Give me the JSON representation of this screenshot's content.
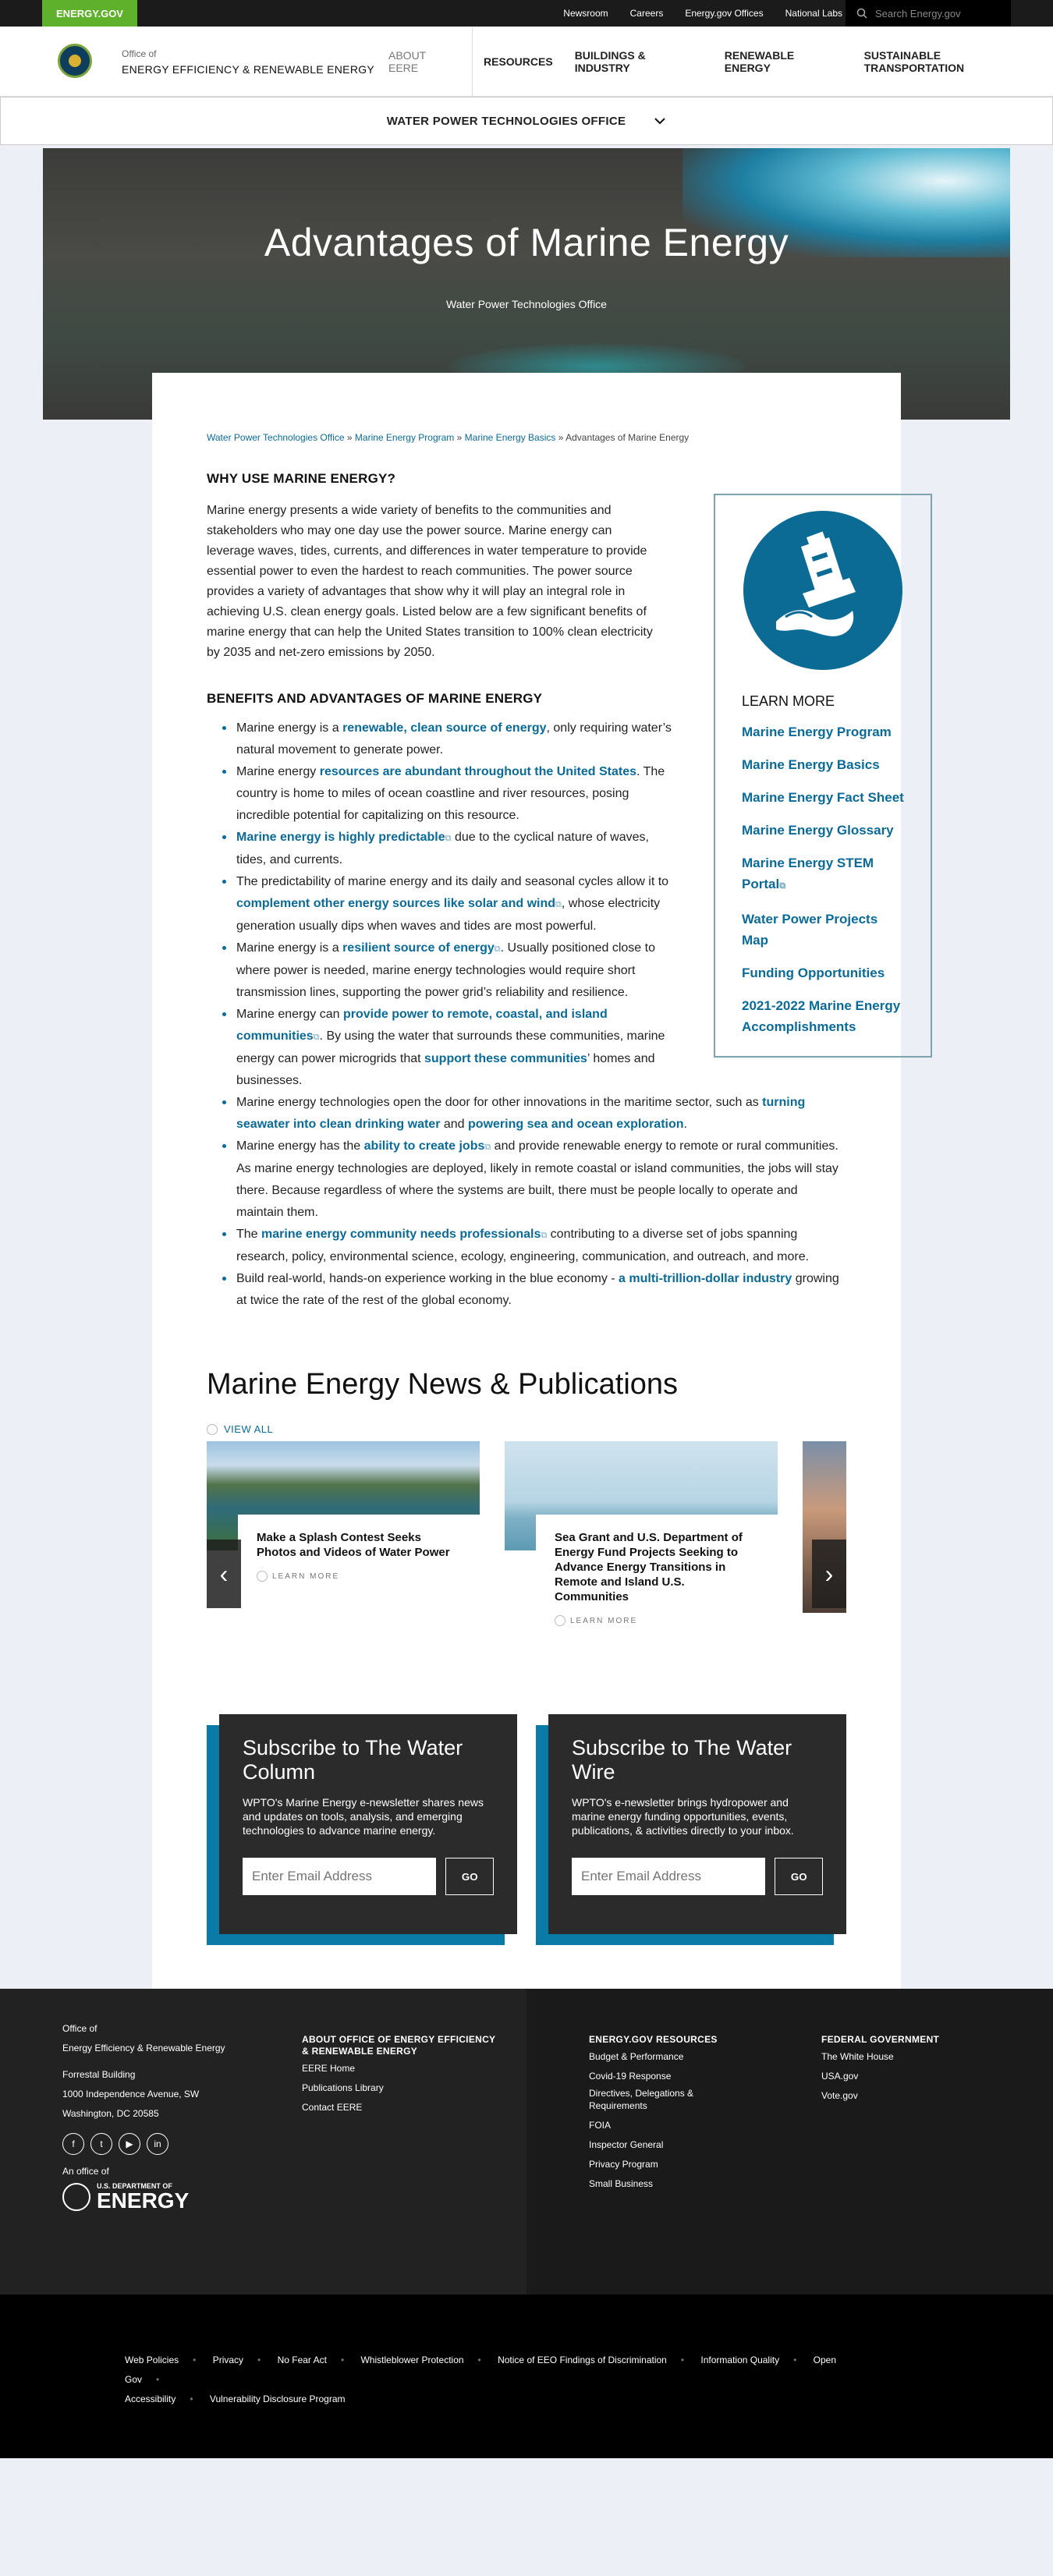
{
  "topbar": {
    "brand": "ENERGY.GOV",
    "links": [
      "Newsroom",
      "Careers",
      "Energy.gov Offices",
      "National Labs"
    ],
    "search_placeholder": "Search Energy.gov"
  },
  "header": {
    "office_of": "Office of",
    "office_name": "ENERGY EFFICIENCY & RENEWABLE ENERGY",
    "nav": [
      "ABOUT EERE",
      "RESOURCES",
      "BUILDINGS & INDUSTRY",
      "RENEWABLE ENERGY",
      "SUSTAINABLE TRANSPORTATION"
    ]
  },
  "subnav": {
    "label": "WATER POWER TECHNOLOGIES OFFICE"
  },
  "hero": {
    "title": "Advantages of Marine Energy",
    "subtitle": "Water Power Technologies Office"
  },
  "breadcrumbs": {
    "items": [
      "Water Power Technologies Office",
      "Marine Energy Program",
      "Marine Energy Basics"
    ],
    "current": "Advantages of Marine Energy",
    "sep": "»"
  },
  "why": {
    "heading": "WHY USE MARINE ENERGY?",
    "text": "Marine energy presents a wide variety of benefits to the communities and stakeholders who may one day use the power source. Marine energy can leverage waves, tides, currents, and differences in water temperature to provide essential power to even the hardest to reach communities. The power source provides a variety of advantages that show why it will play an integral role in achieving U.S. clean energy goals. Listed below are a few significant benefits of marine energy that can help the United States transition to 100% clean electricity by 2035 and net-zero emissions by 2050."
  },
  "learn": {
    "heading": "LEARN MORE",
    "links": [
      "Marine Energy Program",
      "Marine Energy Basics",
      "Marine Energy Fact Sheet",
      "Marine Energy Glossary",
      "Marine Energy STEM Portal",
      "Water Power Projects Map",
      "Funding Opportunities",
      "2021-2022 Marine Energy Accomplishments"
    ]
  },
  "benefits": {
    "heading": "BENEFITS AND ADVANTAGES OF MARINE ENERGY",
    "b1": {
      "pre": "Marine energy is a ",
      "link": "renewable, clean source of energy",
      "post": ", only requiring water’s natural movement to generate power."
    },
    "b2": {
      "pre": "Marine energy ",
      "link": "resources are abundant throughout the United States",
      "post": ". The country is home to miles of ocean coastline and river resources, posing incredible potential for capitalizing on this resource."
    },
    "b3": {
      "link": "Marine energy is highly predictable",
      "post": " due to the cyclical nature of waves, tides, and currents."
    },
    "b4": {
      "pre": "The predictability of marine energy and its daily and seasonal cycles allow it to ",
      "link": "complement other energy sources like solar and wind",
      "post": ", whose electricity generation usually dips when waves and tides are most powerful."
    },
    "b5": {
      "pre": "Marine energy is a ",
      "link": "resilient source of energy",
      "post": ". Usually positioned close to where power is needed, marine energy technologies would require short transmission lines, supporting the power grid’s reliability and resilience."
    },
    "b6": {
      "pre": "Marine energy can ",
      "link": "provide power to remote, coastal, and island communities",
      "mid": ". By using the water that surrounds these communities, marine energy can power microgrids that ",
      "link2": "support these communities",
      "post": "’ homes and businesses."
    },
    "b7": {
      "pre": "Marine energy technologies open the door for other innovations in the maritime sector, such as ",
      "link": "turning seawater into clean drinking water",
      "mid": " and ",
      "link2": "powering sea and ocean exploration",
      "post": "."
    },
    "b8": {
      "pre": "Marine energy has the ",
      "link": "ability to create jobs",
      "post": " and provide renewable energy to remote or rural communities. As marine energy technologies are deployed, likely in remote coastal or island communities, the jobs will stay there. Because regardless of where the systems are built, there must be people locally to operate and maintain them."
    },
    "b9": {
      "pre": "The ",
      "link": "marine energy community needs professionals",
      "post": " contributing to a diverse set of jobs spanning research, policy, environmental science, ecology, engineering, communication, and outreach, and more."
    },
    "b10": {
      "pre": "Build real-world, hands-on experience working in the blue economy - ",
      "link": "a multi-trillion-dollar industry",
      "post": " growing at twice the rate of the rest of the global economy."
    }
  },
  "news": {
    "heading": "Marine Energy News & Publications",
    "view_all": "VIEW ALL",
    "learn_more": "LEARN MORE",
    "cards": [
      {
        "title": "Make a Splash Contest Seeks Photos and Videos of Water Power"
      },
      {
        "title": "Sea Grant and U.S. Department of Energy Fund Projects Seeking to Advance Energy Transitions in Remote and Island U.S. Communities"
      }
    ]
  },
  "subscribe": [
    {
      "title": "Subscribe to The Water Column",
      "text": "WPTO's Marine Energy e-newsletter shares news and updates on tools, analysis, and emerging technologies to advance marine energy.",
      "placeholder": "Enter Email Address",
      "button": "GO"
    },
    {
      "title": "Subscribe to The Water Wire",
      "text": "WPTO's e-newsletter brings hydropower and marine energy funding opportunities, events, publications, & activities directly to your inbox.",
      "placeholder": "Enter Email Address",
      "button": "GO"
    }
  ],
  "footer": {
    "office_of": "Office of",
    "office_name": "Energy Efficiency & Renewable Energy",
    "address": [
      "Forrestal Building",
      "1000 Independence Avenue, SW",
      "Washington, DC 20585"
    ],
    "an_office_of": "An office of",
    "doe_small": "U.S. DEPARTMENT OF",
    "doe_big": "ENERGY",
    "about_heading": "ABOUT OFFICE OF ENERGY EFFICIENCY & RENEWABLE ENERGY",
    "about_links": [
      "EERE Home",
      "Publications Library",
      "Contact EERE"
    ],
    "res_heading": "ENERGY.GOV RESOURCES",
    "res_links": [
      "Budget & Performance",
      "Covid-19 Response",
      "Directives, Delegations & Requirements",
      "FOIA",
      "Inspector General",
      "Privacy Program",
      "Small Business"
    ],
    "fed_heading": "FEDERAL GOVERNMENT",
    "fed_links": [
      "The White House",
      "USA.gov",
      "Vote.gov"
    ]
  },
  "bottom": {
    "links": [
      "Web Policies",
      "Privacy",
      "No Fear Act",
      "Whistleblower Protection",
      "Notice of EEO Findings of Discrimination",
      "Information Quality",
      "Open Gov",
      "Accessibility",
      "Vulnerability Disclosure Program"
    ]
  }
}
